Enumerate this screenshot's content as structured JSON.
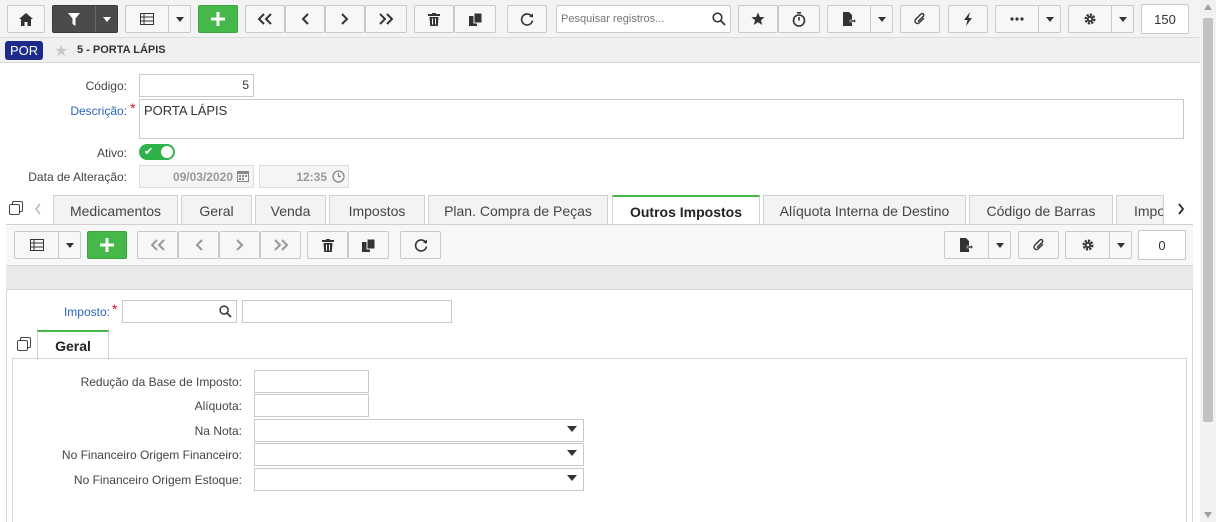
{
  "toolbar": {
    "search_placeholder": "Pesquisar registros...",
    "page_size": "150"
  },
  "record": {
    "badge": "POR",
    "title": "5 - PORTA LÁPIS"
  },
  "form": {
    "codigo_label": "Código:",
    "codigo_value": "5",
    "descricao_label": "Descrição:",
    "descricao_value": "PORTA LÁPIS",
    "ativo_label": "Ativo:",
    "ativo_value": true,
    "data_label": "Data de Alteração:",
    "data_value": "09/03/2020",
    "hora_value": "12:35"
  },
  "tabs": [
    {
      "label": "Medicamentos"
    },
    {
      "label": "Geral"
    },
    {
      "label": "Venda"
    },
    {
      "label": "Impostos"
    },
    {
      "label": "Plan. Compra de Peças"
    },
    {
      "label": "Outros Impostos"
    },
    {
      "label": "Alíquota Interna de Destino"
    },
    {
      "label": "Código de Barras"
    },
    {
      "label": "Impo"
    }
  ],
  "subtoolbar": {
    "count": "0"
  },
  "detail": {
    "imposto_label": "Imposto:",
    "geral_tab": "Geral",
    "fields": [
      {
        "label": "Redução da Base de Imposto:"
      },
      {
        "label": "Alíquota:"
      },
      {
        "label": "Na Nota:"
      },
      {
        "label": "No Financeiro Origem Financeiro:"
      },
      {
        "label": "No Financeiro Origem Estoque:"
      }
    ]
  },
  "colors": {
    "accent_green": "#46b84a",
    "badge_blue": "#1d2a8c",
    "required_red": "#d12222",
    "link_blue": "#2a66c0"
  }
}
